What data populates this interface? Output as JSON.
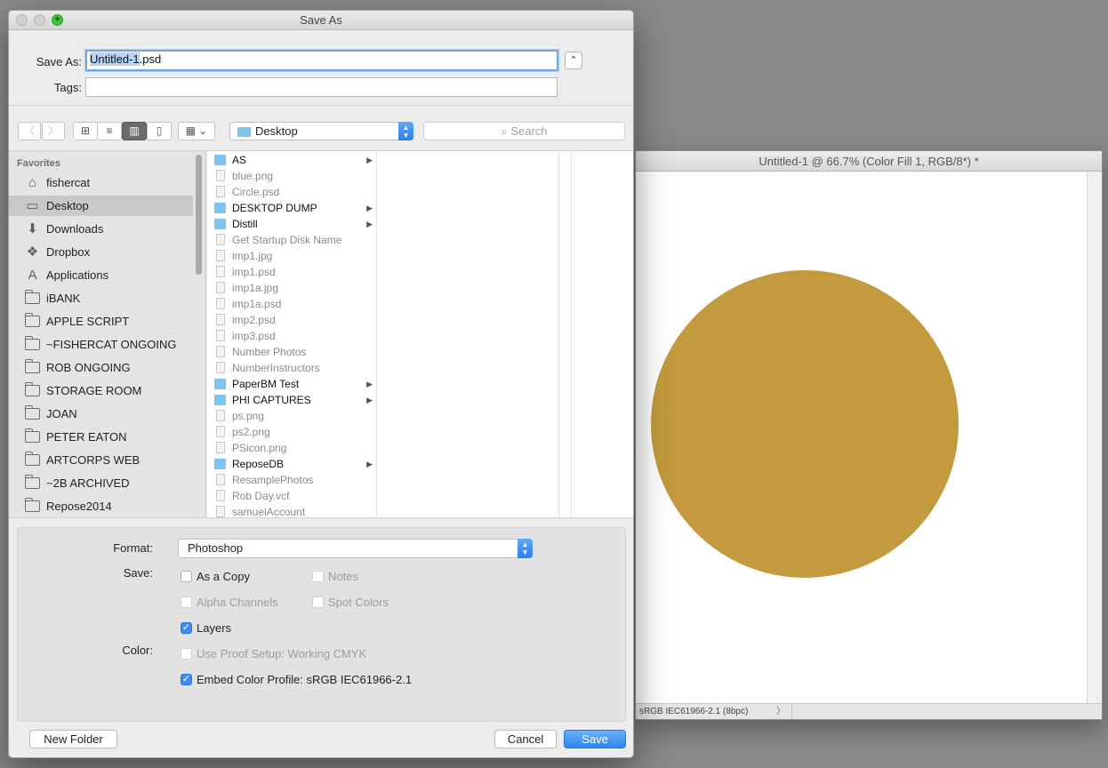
{
  "document_window": {
    "title": "Untitled-1 @ 66.7% (Color Fill 1, RGB/8*) *",
    "status_info": "sRGB IEC61966-2.1 (8bpc)",
    "status_arrow": "〉",
    "shape_color": "#c39a3d"
  },
  "dialog": {
    "title": "Save As",
    "zoom_glyph": "+",
    "save_as_label": "Save As:",
    "filename_selected": "Untitled-1",
    "filename_ext": ".psd",
    "tags_label": "Tags:",
    "tags_value": "",
    "disclosure_glyph": "⌃"
  },
  "toolbar": {
    "back_glyph": "〈",
    "forward_glyph": "〉",
    "view_icons_glyph": "⊞",
    "view_list_glyph": "≡",
    "view_columns_glyph": "▥",
    "view_coverflow_glyph": "▯",
    "arrange_glyph": "▦ ⌄",
    "location": "Desktop",
    "stepper_glyph": "▲\n▼",
    "search_placeholder": "Search",
    "search_glyph": "⌕"
  },
  "sidebar": {
    "heading": "Favorites",
    "items": [
      {
        "label": "fishercat",
        "icon": "home-icon",
        "glyph": "⌂",
        "selected": false
      },
      {
        "label": "Desktop",
        "icon": "desktop-icon",
        "glyph": "▭",
        "selected": true
      },
      {
        "label": "Downloads",
        "icon": "download-icon",
        "glyph": "⬇",
        "selected": false
      },
      {
        "label": "Dropbox",
        "icon": "dropbox-icon",
        "glyph": "❖",
        "selected": false
      },
      {
        "label": "Applications",
        "icon": "applications-icon",
        "glyph": "A",
        "selected": false
      },
      {
        "label": "iBANK",
        "icon": "folder-icon",
        "selected": false
      },
      {
        "label": "APPLE SCRIPT",
        "icon": "folder-icon",
        "selected": false
      },
      {
        "label": "~FISHERCAT ONGOING",
        "icon": "folder-icon",
        "selected": false
      },
      {
        "label": "ROB ONGOING",
        "icon": "folder-icon",
        "selected": false
      },
      {
        "label": "STORAGE ROOM",
        "icon": "folder-icon",
        "selected": false
      },
      {
        "label": "JOAN",
        "icon": "folder-icon",
        "selected": false
      },
      {
        "label": "PETER EATON",
        "icon": "folder-icon",
        "selected": false
      },
      {
        "label": "ARTCORPS WEB",
        "icon": "folder-icon",
        "selected": false
      },
      {
        "label": "~2B ARCHIVED",
        "icon": "folder-icon",
        "selected": false
      },
      {
        "label": "Repose2014",
        "icon": "folder-icon",
        "selected": false
      }
    ]
  },
  "files": [
    {
      "name": "AS",
      "kind": "folder",
      "dim": false
    },
    {
      "name": "blue.png",
      "kind": "file",
      "dim": true
    },
    {
      "name": "Circle.psd",
      "kind": "file",
      "dim": true
    },
    {
      "name": "DESKTOP DUMP",
      "kind": "folder",
      "dim": false
    },
    {
      "name": "Distill",
      "kind": "folder",
      "dim": false
    },
    {
      "name": "Get Startup Disk Name",
      "kind": "file",
      "dim": true
    },
    {
      "name": "imp1.jpg",
      "kind": "file",
      "dim": true
    },
    {
      "name": "imp1.psd",
      "kind": "file",
      "dim": true
    },
    {
      "name": "imp1a.jpg",
      "kind": "file",
      "dim": true
    },
    {
      "name": "imp1a.psd",
      "kind": "file",
      "dim": true
    },
    {
      "name": "imp2.psd",
      "kind": "file",
      "dim": true
    },
    {
      "name": "imp3.psd",
      "kind": "file",
      "dim": true
    },
    {
      "name": "Number Photos",
      "kind": "file",
      "dim": true
    },
    {
      "name": "NumberInstructors",
      "kind": "file",
      "dim": true
    },
    {
      "name": "PaperBM Test",
      "kind": "folder",
      "dim": false
    },
    {
      "name": "PHI CAPTURES",
      "kind": "folder",
      "dim": false
    },
    {
      "name": "ps.png",
      "kind": "file",
      "dim": true
    },
    {
      "name": "ps2.png",
      "kind": "file",
      "dim": true
    },
    {
      "name": "PSicon.png",
      "kind": "file",
      "dim": true
    },
    {
      "name": "ReposeDB",
      "kind": "folder",
      "dim": false
    },
    {
      "name": "ResamplePhotos",
      "kind": "file",
      "dim": true
    },
    {
      "name": "Rob Day.vcf",
      "kind": "file",
      "dim": true
    },
    {
      "name": "samuelAccount",
      "kind": "file",
      "dim": true
    }
  ],
  "folder_arrow": "▶",
  "options": {
    "format_label": "Format:",
    "format_value": "Photoshop",
    "save_label": "Save:",
    "color_label": "Color:",
    "check_glyph": "✓",
    "as_a_copy": "As a Copy",
    "notes": "Notes",
    "alpha_channels": "Alpha Channels",
    "spot_colors": "Spot Colors",
    "layers": "Layers",
    "use_proof_setup": "Use Proof Setup:  Working CMYK",
    "embed_color_profile": "Embed Color Profile:  sRGB IEC61966-2.1"
  },
  "buttons": {
    "new_folder": "New Folder",
    "cancel": "Cancel",
    "save": "Save"
  }
}
